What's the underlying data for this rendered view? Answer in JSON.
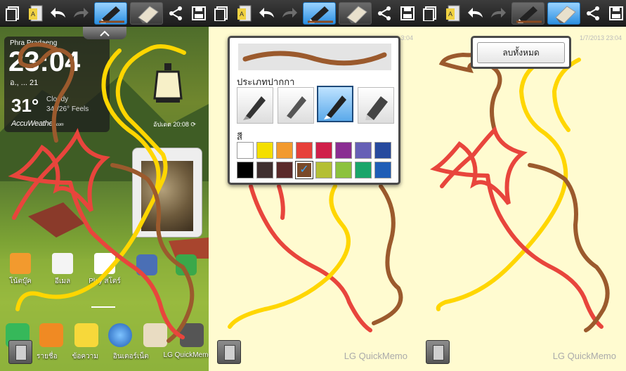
{
  "toolbar": {
    "icons": [
      "new-memo-icon",
      "memo-list-icon",
      "undo-icon",
      "redo-icon",
      "pen-icon",
      "eraser-icon",
      "share-icon",
      "save-icon"
    ]
  },
  "home": {
    "weather": {
      "location": "Phra Pradaeng",
      "time": "23:04",
      "date": "อ., ... 21",
      "temp": "31°",
      "condition": "Cloudy",
      "range": "34°/26°",
      "feels": "Feels",
      "brand": "AccuWeather",
      "brand_suffix": ".com",
      "updated": "อัปเดต 20:08"
    },
    "apps": [
      {
        "label": "โน้ตบุ๊ค"
      },
      {
        "label": "อีเมล"
      },
      {
        "label": "Play สโตร์"
      }
    ],
    "dock": [
      "รายชื่อ",
      "ข้อความ",
      "อินเตอร์เน็ต",
      "LG QuickMemo"
    ]
  },
  "memo": {
    "watermark": "LG QuickMemo",
    "timestamp_p2": "3:04",
    "timestamp_p3": "1/7/2013 23:04"
  },
  "pen_popup": {
    "type_label": "ประเภทปากกา",
    "color_label": "สี",
    "selected_color": "#7a4a2a",
    "colors_row1": [
      "#ffffff",
      "#f4df00",
      "#f29a2e",
      "#e7403a",
      "#d0204a",
      "#8a2e92",
      "#6660b6",
      "#274a9e"
    ],
    "colors_row2": [
      "#000000",
      "#3f2f2f",
      "#5b2a2a",
      "#7a4a2a",
      "#b4bf34",
      "#8cc23e",
      "#1aa56a",
      "#1f5db6"
    ]
  },
  "clear_popup": {
    "label": "ลบทั้งหมด"
  },
  "colors": {
    "yellow": "#ffd600",
    "red": "#e8453c",
    "brown": "#9b5a2d",
    "active": "#2c8fe0"
  }
}
